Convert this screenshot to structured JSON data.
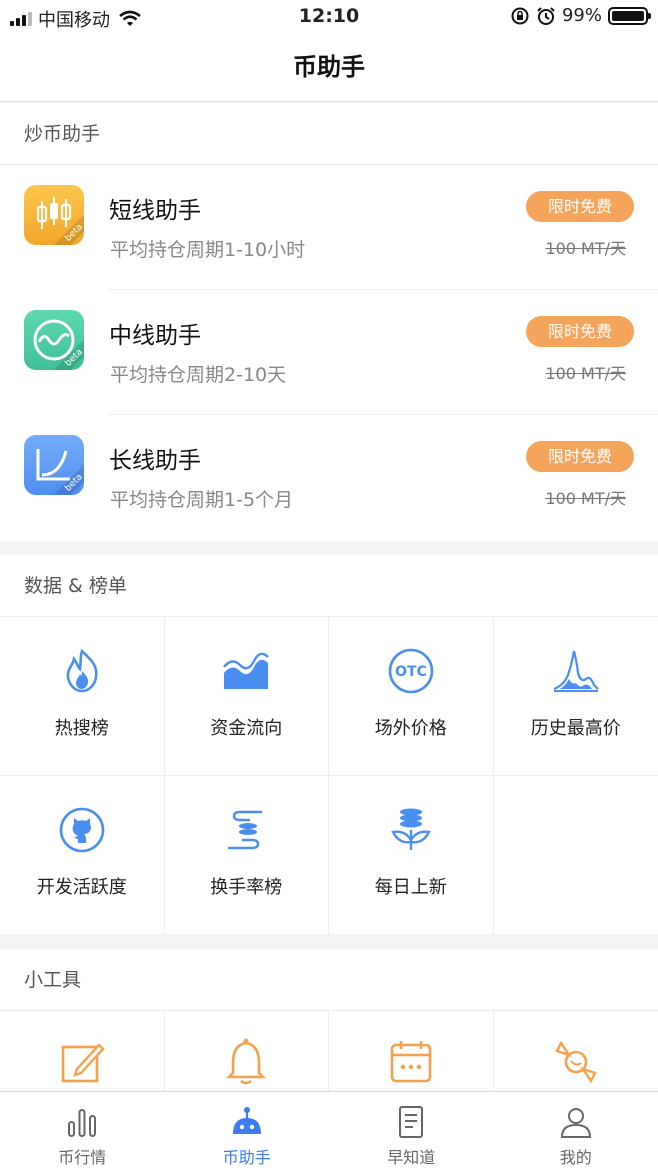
{
  "status_bar": {
    "carrier": "中国移动",
    "time": "12:10",
    "battery": "99%",
    "battery_level": 0.99
  },
  "nav": {
    "title": "币助手"
  },
  "assistants_section": {
    "title": "炒币助手",
    "items": [
      {
        "name": "短线助手",
        "desc": "平均持仓周期1-10小时",
        "badge": "限时免费",
        "price": "100 MT/天",
        "icon": "candlestick-icon",
        "color": "#f6b43c",
        "beta": "beta"
      },
      {
        "name": "中线助手",
        "desc": "平均持仓周期2-10天",
        "badge": "限时免费",
        "price": "100 MT/天",
        "icon": "wave-circle-icon",
        "color": "#4fd0a6",
        "beta": "beta"
      },
      {
        "name": "长线助手",
        "desc": "平均持仓周期1-5个月",
        "badge": "限时免费",
        "price": "100 MT/天",
        "icon": "curve-chart-icon",
        "color": "#5b9cf5",
        "beta": "beta"
      }
    ]
  },
  "data_section": {
    "title": "数据 & 榜单",
    "items": [
      {
        "label": "热搜榜",
        "icon": "flame-icon"
      },
      {
        "label": "资金流向",
        "icon": "area-chart-icon"
      },
      {
        "label": "场外价格",
        "icon": "otc-icon",
        "icon_text": "OTC"
      },
      {
        "label": "历史最高价",
        "icon": "peak-chart-icon"
      },
      {
        "label": "开发活跃度",
        "icon": "github-icon"
      },
      {
        "label": "换手率榜",
        "icon": "hand-coins-icon"
      },
      {
        "label": "每日上新",
        "icon": "coin-sprout-icon"
      }
    ]
  },
  "tools_section": {
    "title": "小工具",
    "items": [
      {
        "icon": "edit-icon"
      },
      {
        "icon": "bell-icon"
      },
      {
        "icon": "calendar-icon"
      },
      {
        "icon": "candy-icon"
      }
    ]
  },
  "tab_bar": {
    "tabs": [
      {
        "label": "币行情",
        "icon": "bar-chart-icon",
        "active": false
      },
      {
        "label": "币助手",
        "icon": "robot-icon",
        "active": true
      },
      {
        "label": "早知道",
        "icon": "document-icon",
        "active": false
      },
      {
        "label": "我的",
        "icon": "user-icon",
        "active": false
      }
    ]
  },
  "colors": {
    "accent": "#3d7cf0",
    "badge": "#f5a45b",
    "icon_blue": "#4a8ef0",
    "icon_orange": "#f5a04a"
  }
}
